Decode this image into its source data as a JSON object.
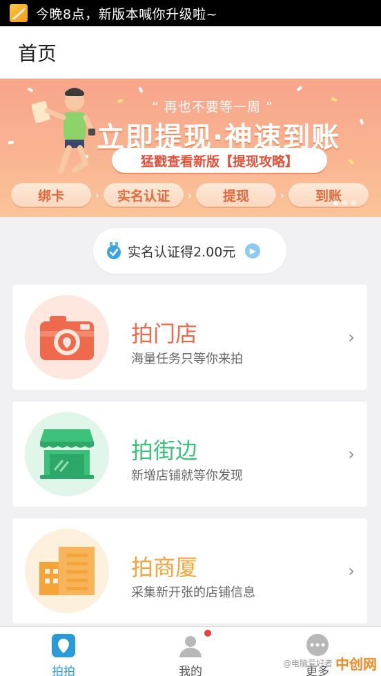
{
  "status_bar": {
    "notification": "今晚8点，新版本喊你升级啦~"
  },
  "header": {
    "title": "首页"
  },
  "banner": {
    "quote": "“ 再也不要等一周 ”",
    "headline": "立即提现·神速到账",
    "cta": "猛戳查看新版【提现攻略】",
    "steps": [
      "绑卡",
      "实名认证",
      "提现",
      "到账"
    ],
    "colors": {
      "background": "#f9b491",
      "accent": "#e2503a"
    }
  },
  "verify": {
    "label": "实名认证得2.00元"
  },
  "tasks": [
    {
      "title": "拍门店",
      "subtitle": "海量任务只等你来拍",
      "icon": "camera-icon",
      "color": "#ef6a4c",
      "bg": "#fde7df"
    },
    {
      "title": "拍街边",
      "subtitle": "新增店铺就等你发现",
      "icon": "storefront-icon",
      "color": "#3cc07a",
      "bg": "#dff6e8"
    },
    {
      "title": "拍商厦",
      "subtitle": "采集新开张的店铺信息",
      "icon": "building-icon",
      "color": "#f5a43a",
      "bg": "#fdf0dc"
    }
  ],
  "tabbar": {
    "tabs": [
      {
        "label": "拍拍",
        "icon": "location-pin-icon"
      },
      {
        "label": "我的",
        "icon": "person-icon"
      },
      {
        "label": "更多",
        "icon": "chat-dots-icon"
      }
    ],
    "watermark_caption": "@电脑爱好者",
    "watermark_logo": "中创网",
    "active_color": "#2b9bd8"
  }
}
